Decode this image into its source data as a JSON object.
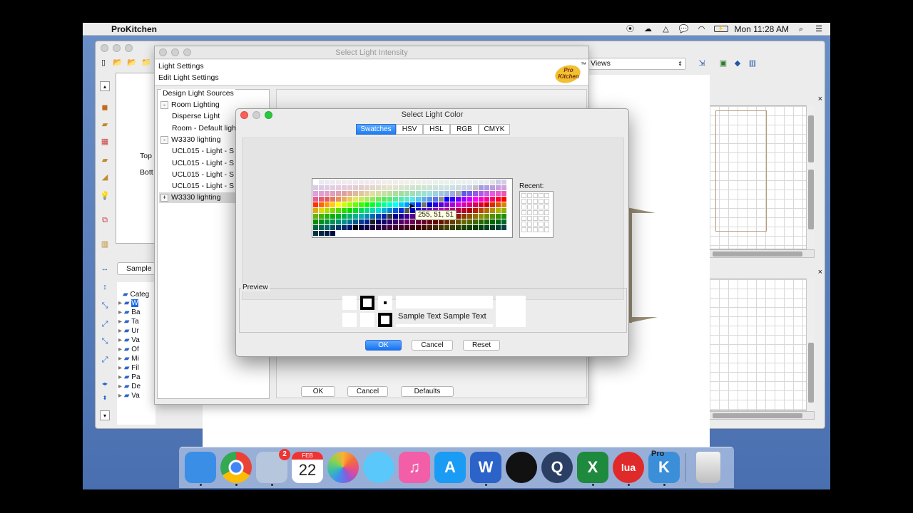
{
  "menubar": {
    "app_name": "ProKitchen",
    "clock": "Mon 11:28 AM",
    "icons": [
      "apple-icon",
      "record-icon",
      "creative-cloud-icon",
      "google-drive-icon",
      "messages-icon",
      "wifi-icon",
      "battery-icon",
      "spotlight-icon",
      "notification-center-icon"
    ]
  },
  "app_window": {
    "views_select": "Views",
    "left_panel": {
      "top_label": "Top",
      "bottom_label": "Bott",
      "sample_label": "Sample",
      "category_root": "Categ",
      "category_items": [
        "W",
        "Ba",
        "Ta",
        "Ur",
        "Va",
        "Of",
        "Mi",
        "Fil",
        "Pa",
        "De",
        "Va"
      ]
    }
  },
  "intensity_dialog": {
    "title": "Select Light Intensity",
    "menu_light_settings": "Light Settings",
    "menu_edit_light_settings": "Edit Light Settings",
    "logo_text": "Pro Kitchen",
    "logo_tm": "™",
    "tree_title": "Design Light Sources",
    "tree": [
      {
        "toggle": "-",
        "label": "Room Lighting",
        "indent": 0
      },
      {
        "toggle": "",
        "label": "Disperse Light",
        "indent": 1
      },
      {
        "toggle": "",
        "label": "Room - Default ligh",
        "indent": 1
      },
      {
        "toggle": "-",
        "label": "W3330 lighting",
        "indent": 0
      },
      {
        "toggle": "",
        "label": "UCL015 - Light - S",
        "indent": 1
      },
      {
        "toggle": "",
        "label": "UCL015 - Light - S",
        "indent": 1
      },
      {
        "toggle": "",
        "label": "UCL015 - Light - S",
        "indent": 1
      },
      {
        "toggle": "",
        "label": "UCL015 - Light - S",
        "indent": 1
      },
      {
        "toggle": "+",
        "label": "W3330 lighting",
        "indent": 0
      }
    ],
    "ok_label": "OK",
    "cancel_label": "Cancel",
    "defaults_label": "Defaults"
  },
  "color_dialog": {
    "title": "Select Light Color",
    "tabs": [
      "Swatches",
      "HSV",
      "HSL",
      "RGB",
      "CMYK"
    ],
    "selected_tab": "Swatches",
    "recent_label": "Recent:",
    "tooltip": "255, 51, 51",
    "preview_label": "Preview",
    "sample_text": "Sample Text",
    "ok_label": "OK",
    "cancel_label": "Cancel",
    "reset_label": "Reset"
  },
  "dock": {
    "apps": [
      {
        "name": "finder",
        "label": "",
        "color": "#3a8ee6"
      },
      {
        "name": "chrome",
        "label": "",
        "color": "#e8e8e8"
      },
      {
        "name": "mail",
        "label": "",
        "color": "#b6c6dc",
        "badge": "2"
      },
      {
        "name": "calendar",
        "label": "22",
        "month": "FEB",
        "color": "#ffffff"
      },
      {
        "name": "photos",
        "label": "",
        "color": "#ffffff"
      },
      {
        "name": "messages",
        "label": "",
        "color": "#5ac8fa"
      },
      {
        "name": "itunes",
        "label": "♫",
        "color": "#f25ea8"
      },
      {
        "name": "app-store",
        "label": "A",
        "color": "#1a9cf5"
      },
      {
        "name": "word",
        "label": "W",
        "color": "#2b63c9"
      },
      {
        "name": "spotify",
        "label": "",
        "color": "#1ed760"
      },
      {
        "name": "quicktime",
        "label": "Q",
        "color": "#2a3f63"
      },
      {
        "name": "excel",
        "label": "X",
        "color": "#1e8a3e"
      },
      {
        "name": "lua",
        "label": "lua",
        "color": "#e02a2a"
      },
      {
        "name": "prokitchen",
        "label": "K",
        "sublabel": "Pro",
        "color": "#3b8fd8"
      },
      {
        "name": "trash",
        "label": "",
        "color": "#d8d8d8"
      }
    ]
  }
}
